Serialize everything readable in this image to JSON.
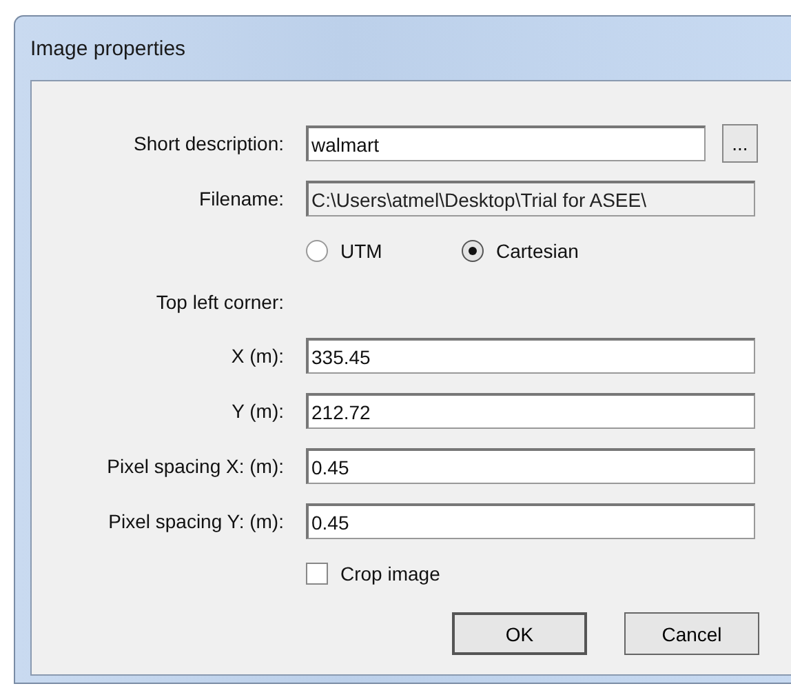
{
  "window": {
    "title": "Image properties"
  },
  "short_description": {
    "label": "Short description:",
    "value": "walmart",
    "browse_button": "..."
  },
  "filename": {
    "label": "Filename:",
    "value": "C:\\Users\\atmel\\Desktop\\Trial for ASEE\\"
  },
  "coordinate_system": [
    {
      "label": "UTM",
      "selected": false
    },
    {
      "label": "Cartesian",
      "selected": true
    }
  ],
  "section_label": "Top left corner:",
  "fields": [
    {
      "label": "X (m):",
      "value": "335.45"
    },
    {
      "label": "Y (m):",
      "value": "212.72"
    },
    {
      "label": "Pixel spacing X: (m):",
      "value": "0.45"
    },
    {
      "label": "Pixel spacing Y: (m):",
      "value": "0.45"
    }
  ],
  "crop_image": {
    "label": "Crop image",
    "checked": false
  },
  "buttons": [
    {
      "label": "OK",
      "kind": "default"
    },
    {
      "label": "Cancel",
      "kind": "normal"
    }
  ]
}
